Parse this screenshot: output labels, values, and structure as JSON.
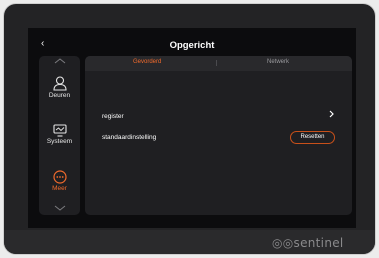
{
  "header": {
    "back_icon": "chevron-left-icon",
    "back_glyph": "‹",
    "title": "Opgericht"
  },
  "sidebar": {
    "items": [
      {
        "label": "Deuren",
        "icon": "user-icon"
      },
      {
        "label": "Systeem",
        "icon": "monitor-icon"
      },
      {
        "label": "Meer",
        "icon": "more-icon",
        "active": true
      }
    ]
  },
  "tabs": [
    {
      "label": "Gevorderd",
      "active": true
    },
    {
      "label": "Netwerk"
    }
  ],
  "settings": {
    "register_label": "register",
    "reset_label": "standaardinstelling",
    "reset_button": "Resetten"
  },
  "brand": "◎◎sentinel",
  "colors": {
    "accent": "#f06a2c",
    "panel": "#1f1f22",
    "background": "#0c0c0e"
  }
}
